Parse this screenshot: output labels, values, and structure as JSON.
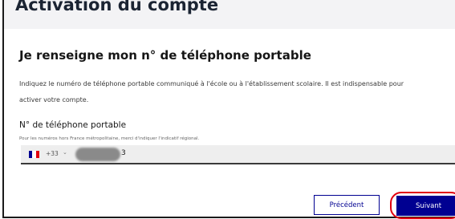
{
  "page": {
    "title": "Activation du compte"
  },
  "section": {
    "title": "Je renseigne mon n° de téléphone portable",
    "intro": "Indiquez le numéro de téléphone portable communiqué à l'école ou à l'établissement scolaire. Il est indispensable pour activer votre compte."
  },
  "phone_field": {
    "label": "N° de téléphone portable",
    "hint": "Pour les numéros hors France métropolitaine, merci d'indiquer l'indicatif régional.",
    "country_flag": "france-flag-icon",
    "dial_code": "+33",
    "chevron": "chevron-down-icon",
    "visible_digit": "3",
    "value_redacted": true
  },
  "actions": {
    "previous_label": "Précédent",
    "next_label": "Suivant"
  },
  "colors": {
    "primary_blue": "#000091",
    "flag_blue": "#000091",
    "flag_white": "#ffffff",
    "flag_red": "#e1000f",
    "highlight_red": "#e1000f",
    "input_background": "#eeeeee"
  }
}
